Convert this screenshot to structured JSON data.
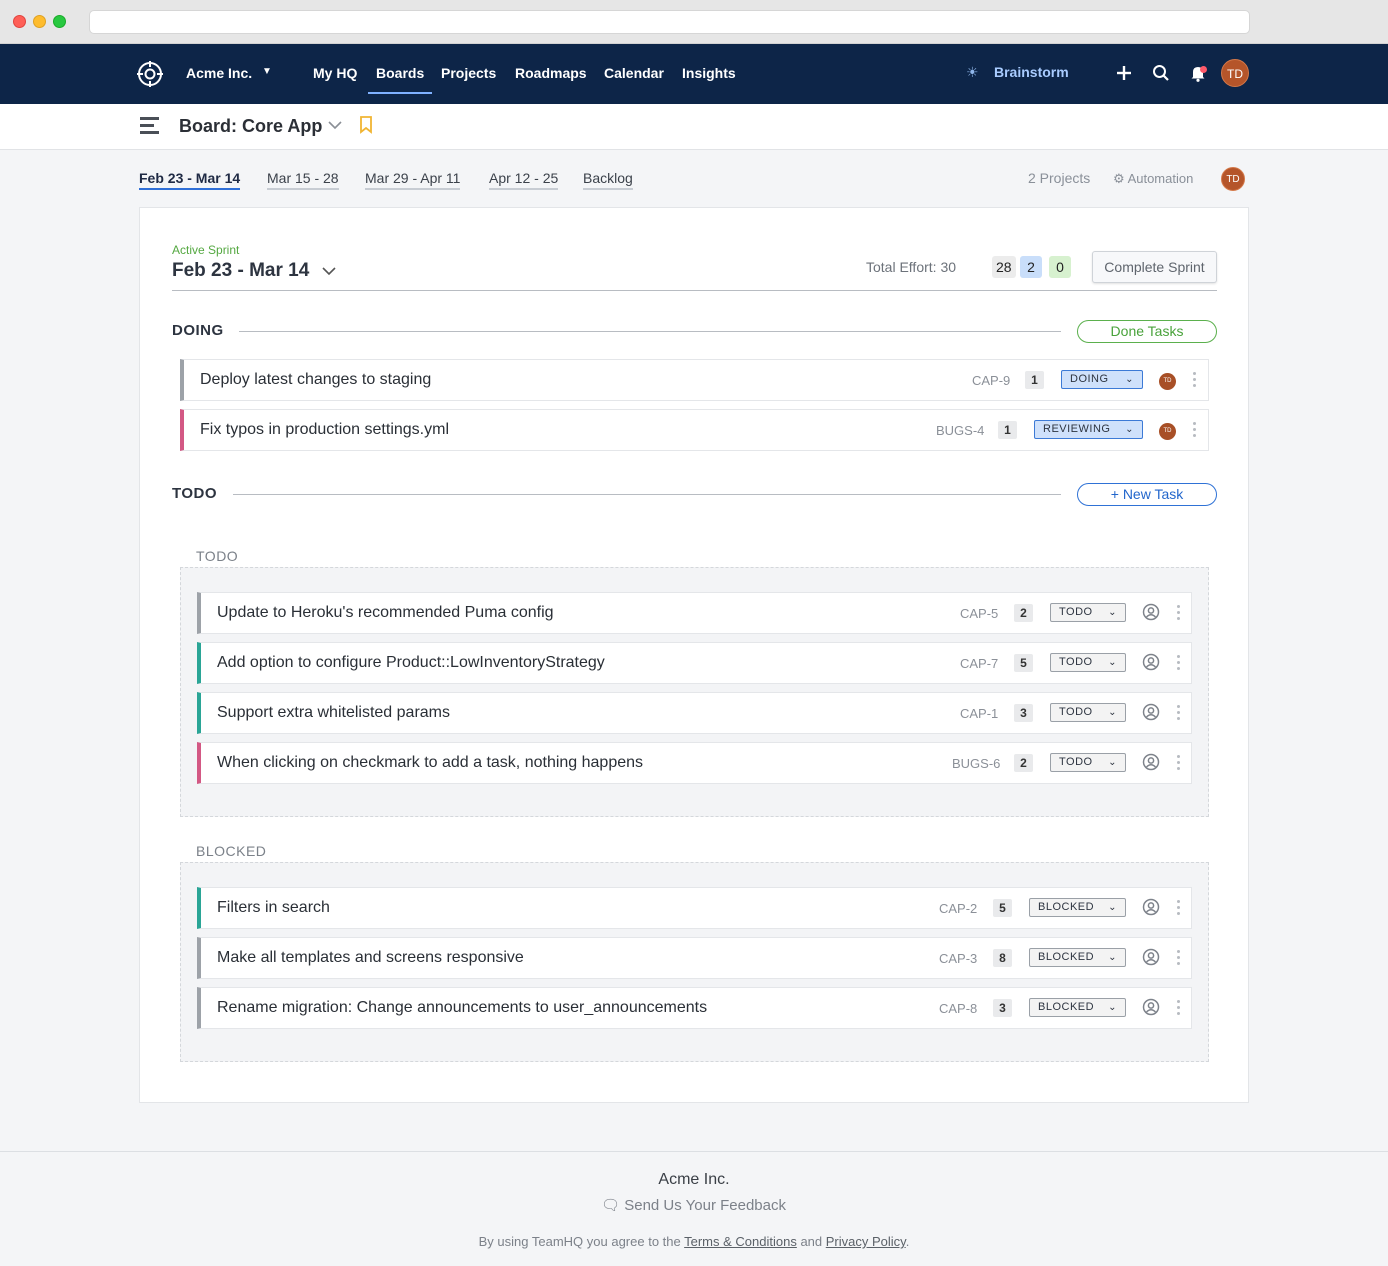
{
  "topnav": {
    "org": "Acme Inc.",
    "links": [
      "My HQ",
      "Boards",
      "Projects",
      "Roadmaps",
      "Calendar",
      "Insights"
    ],
    "active_link": "Boards",
    "brainstorm": "Brainstorm",
    "user_initials": "TD"
  },
  "board": {
    "title": "Board: Core App"
  },
  "sprint_tabs": [
    "Feb 23 - Mar 14",
    "Mar 15 - 28",
    "Mar 29 - Apr 11",
    "Apr 12 - 25",
    "Backlog"
  ],
  "active_sprint_tab": "Feb 23 - Mar 14",
  "projects_count": "2 Projects",
  "automation_label": "Automation",
  "sprint": {
    "active_label": "Active Sprint",
    "title": "Feb 23 - Mar 14",
    "total_effort_label": "Total Effort: 30",
    "effort_todo": "28",
    "effort_doing": "2",
    "effort_done": "0",
    "complete_button": "Complete Sprint"
  },
  "doing": {
    "title": "DOING",
    "button": "Done Tasks",
    "tasks": [
      {
        "title": "Deploy latest changes to staging",
        "key": "CAP-9",
        "points": "1",
        "status": "DOING",
        "assignee": "TD",
        "color": "#9da2a8"
      },
      {
        "title": "Fix typos in production settings.yml",
        "key": "BUGS-4",
        "points": "1",
        "status": "REVIEWING",
        "assignee": "TD",
        "color": "#d35884"
      }
    ]
  },
  "todo": {
    "title": "TODO",
    "button": "New Task",
    "groups": [
      {
        "label": "TODO",
        "tasks": [
          {
            "title": "Update to Heroku's recommended Puma config",
            "key": "CAP-5",
            "points": "2",
            "status": "TODO",
            "color": "#9da2a8"
          },
          {
            "title": "Add option to configure Product::LowInventoryStrategy",
            "key": "CAP-7",
            "points": "5",
            "status": "TODO",
            "color": "#2aa596"
          },
          {
            "title": "Support extra whitelisted params",
            "key": "CAP-1",
            "points": "3",
            "status": "TODO",
            "color": "#2aa596"
          },
          {
            "title": "When clicking on checkmark to add a task, nothing happens",
            "key": "BUGS-6",
            "points": "2",
            "status": "TODO",
            "color": "#d35884"
          }
        ]
      },
      {
        "label": "BLOCKED",
        "tasks": [
          {
            "title": "Filters in search",
            "key": "CAP-2",
            "points": "5",
            "status": "BLOCKED",
            "color": "#2aa596"
          },
          {
            "title": "Make all templates and screens responsive",
            "key": "CAP-3",
            "points": "8",
            "status": "BLOCKED",
            "color": "#9da2a8"
          },
          {
            "title": "Rename migration: Change announcements to user_announcements",
            "key": "CAP-8",
            "points": "3",
            "status": "BLOCKED",
            "color": "#9da2a8"
          }
        ]
      }
    ]
  },
  "footer": {
    "org": "Acme Inc.",
    "feedback": "Send Us Your Feedback",
    "legal_prefix": "By using TeamHQ you agree to the ",
    "terms": "Terms & Conditions",
    "legal_and": " and ",
    "privacy": "Privacy Policy",
    "legal_suffix": "."
  }
}
